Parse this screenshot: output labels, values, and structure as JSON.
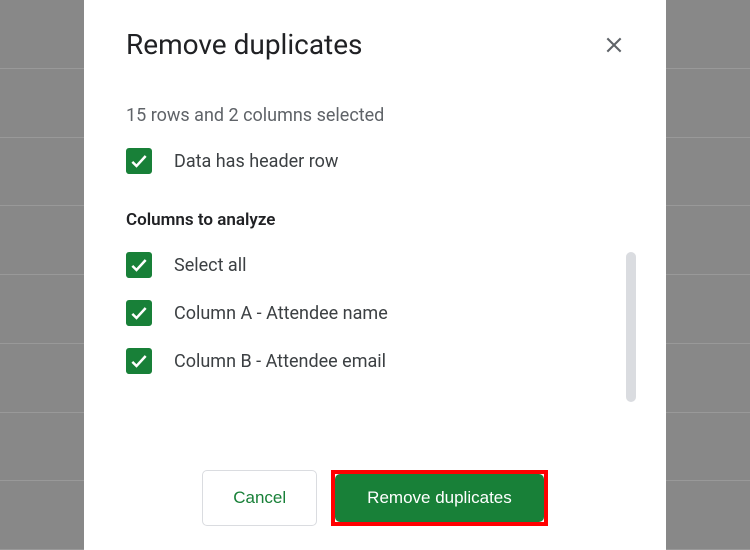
{
  "dialog": {
    "title": "Remove duplicates",
    "selectionInfo": "15 rows and 2 columns selected",
    "headerRowLabel": "Data has header row",
    "sectionTitle": "Columns to analyze",
    "columns": {
      "selectAll": "Select all",
      "colA": "Column A - Attendee name",
      "colB": "Column B - Attendee email"
    },
    "buttons": {
      "cancel": "Cancel",
      "confirm": "Remove duplicates"
    }
  }
}
